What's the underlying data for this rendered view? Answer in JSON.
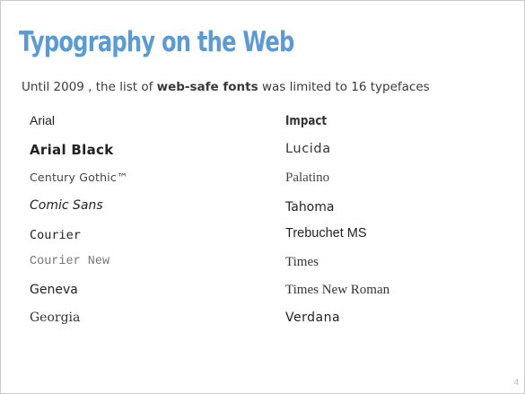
{
  "slide": {
    "title": "Typography on the Web",
    "subtitle": {
      "prefix": "Until 2009 , the list of ",
      "bold": "web-safe fonts",
      "suffix": " was limited to 16 typefaces"
    },
    "fonts_left": [
      "Arial",
      "Arial Black",
      "Century Gothic™",
      "Comic Sans",
      "Courier",
      "Courier New",
      "Geneva",
      "Georgia"
    ],
    "fonts_right": [
      "Impact",
      "Lucida",
      "Palatino",
      "Tahoma",
      "Trebuchet MS",
      "Times",
      "Times New Roman",
      "Verdana"
    ],
    "page_number": "4"
  },
  "colors": {
    "title": "#5b9bd5",
    "text": "#333333",
    "border": "#c9c9c9"
  }
}
